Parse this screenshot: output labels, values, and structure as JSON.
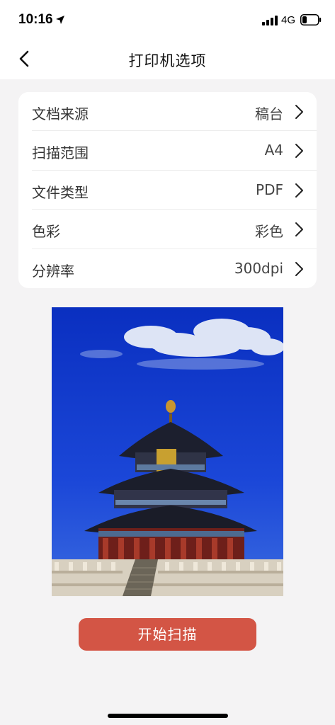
{
  "status_bar": {
    "time": "10:16",
    "network": "4G",
    "icons": [
      "location-arrow-icon",
      "cellular-signal-icon",
      "battery-icon"
    ]
  },
  "nav": {
    "title": "打印机选项",
    "back_icon": "chevron-left-icon"
  },
  "settings": [
    {
      "label": "文档来源",
      "value": "稿台"
    },
    {
      "label": "扫描范围",
      "value": "A4"
    },
    {
      "label": "文件类型",
      "value": "PDF"
    },
    {
      "label": "色彩",
      "value": "彩色"
    },
    {
      "label": "分辨率",
      "value": "300dpi"
    }
  ],
  "preview": {
    "description_icon": "temple-of-heaven-photo"
  },
  "actions": {
    "scan_label": "开始扫描"
  },
  "colors": {
    "accent": "#d35545",
    "background": "#f4f3f4",
    "card": "#ffffff"
  }
}
